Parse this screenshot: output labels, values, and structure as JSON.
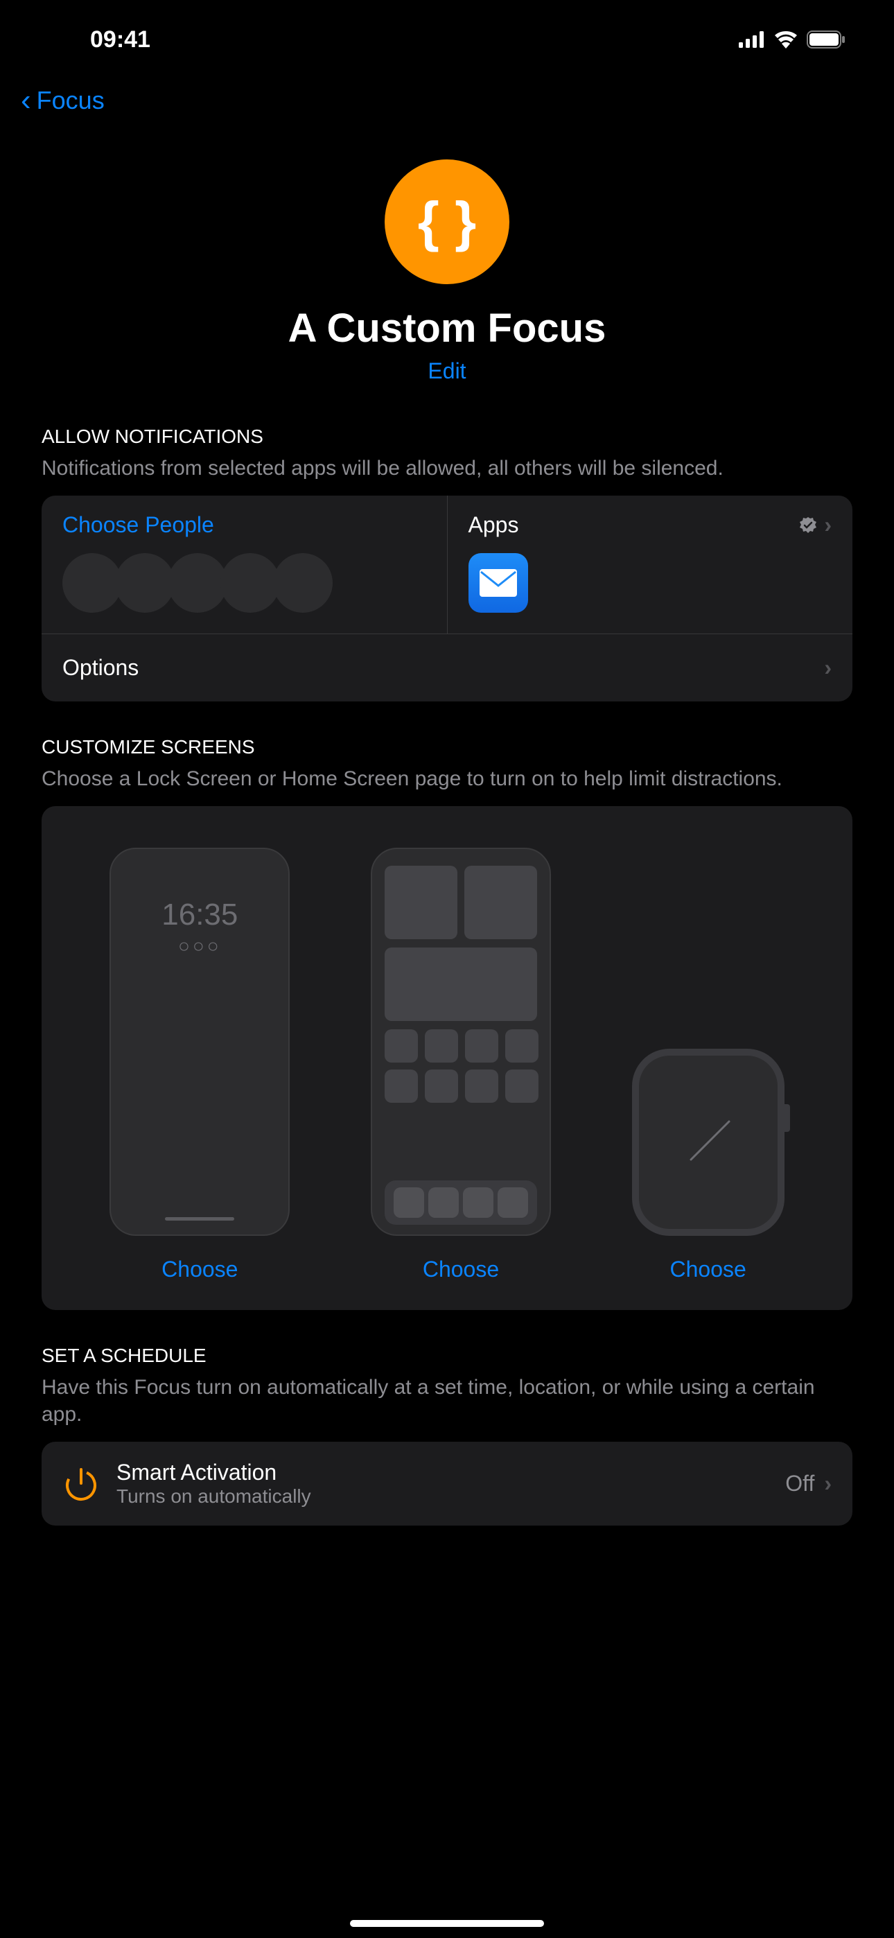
{
  "status": {
    "time": "09:41"
  },
  "nav": {
    "back_label": "Focus"
  },
  "header": {
    "icon_glyph": "{ }",
    "title": "A Custom Focus",
    "edit_label": "Edit"
  },
  "allow_notifications": {
    "header": "ALLOW NOTIFICATIONS",
    "desc": "Notifications from selected apps will be allowed, all others will be silenced.",
    "people": {
      "title": "Choose People",
      "placeholder_count": 5
    },
    "apps": {
      "title": "Apps",
      "selected": [
        "Mail"
      ]
    },
    "options_label": "Options"
  },
  "customize_screens": {
    "header": "CUSTOMIZE SCREENS",
    "desc": "Choose a Lock Screen or Home Screen page to turn on to help limit distractions.",
    "lock_time": "16:35",
    "choose_label": "Choose"
  },
  "schedule": {
    "header": "SET A SCHEDULE",
    "desc": "Have this Focus turn on automatically at a set time, location, or while using a certain app.",
    "smart": {
      "title": "Smart Activation",
      "subtitle": "Turns on automatically",
      "value": "Off"
    }
  }
}
